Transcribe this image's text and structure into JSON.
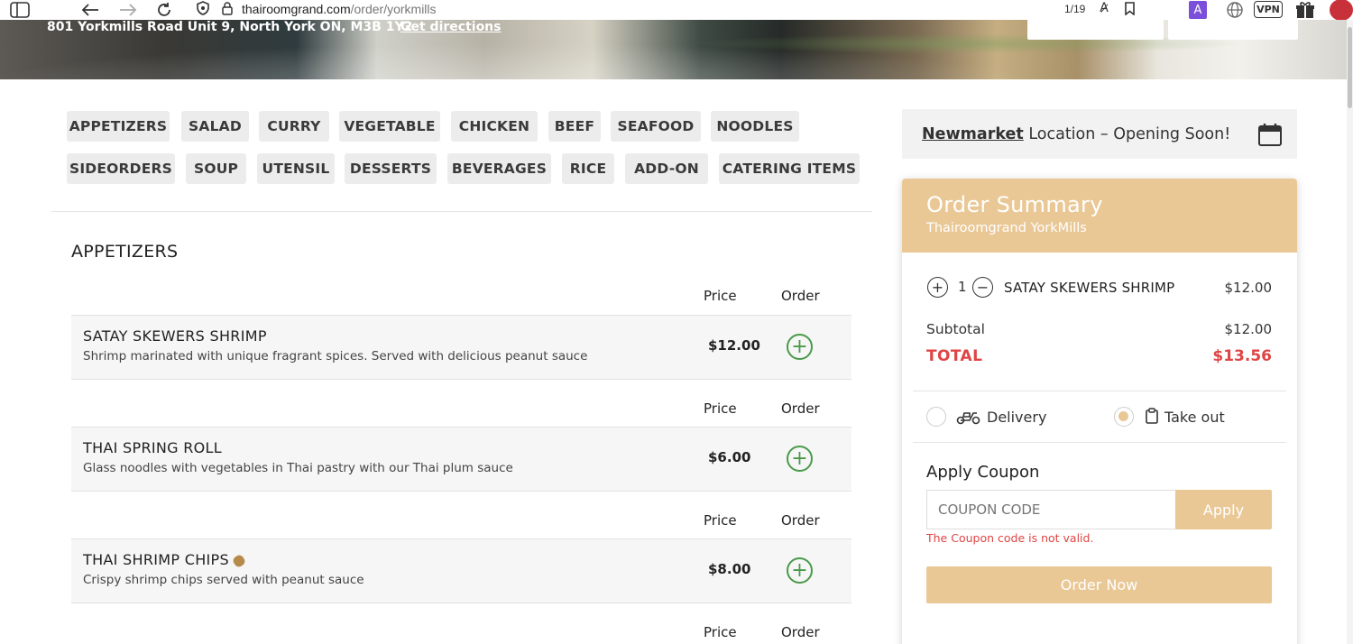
{
  "browser": {
    "url_domain": "thairoomgrand.com",
    "url_path": "/order/yorkmills",
    "page_count": "1/19",
    "vpn_label": "VPN",
    "ext_label": "A"
  },
  "hero": {
    "address": "801 Yorkmills Road Unit 9, North York ON, M3B 1Y2",
    "directions": "Get directions"
  },
  "categories": [
    "APPETIZERS",
    "SALAD",
    "CURRY",
    "VEGETABLE",
    "CHICKEN",
    "BEEF",
    "SEAFOOD",
    "NOODLES",
    "SIDEORDERS",
    "SOUP",
    "UTENSIL",
    "DESSERTS",
    "BEVERAGES",
    "RICE",
    "ADD-ON",
    "CATERING ITEMS"
  ],
  "menu": {
    "section_title": "APPETIZERS",
    "price_header": "Price",
    "order_header": "Order",
    "items": [
      {
        "name": "SATAY SKEWERS SHRIMP",
        "desc": "Shrimp marinated with unique fragrant spices. Served with delicious peanut sauce",
        "price": "$12.00"
      },
      {
        "name": "THAI SPRING ROLL",
        "desc": "Glass noodles with vegetables in Thai pastry with our Thai plum sauce",
        "price": "$6.00"
      },
      {
        "name": "THAI SHRIMP CHIPS",
        "desc": "Crispy shrimp chips served with peanut sauce",
        "price": "$8.00"
      }
    ]
  },
  "notice": {
    "location": "Newmarket",
    "text": " Location – Opening Soon!"
  },
  "summary": {
    "title": "Order Summary",
    "subtitle": "Thairoomgrand YorkMills",
    "cart": {
      "qty": "1",
      "name": "SATAY SKEWERS SHRIMP",
      "price": "$12.00"
    },
    "subtotal_label": "Subtotal",
    "subtotal": "$12.00",
    "total_label": "TOTAL",
    "total": "$13.56",
    "delivery_label": "Delivery",
    "takeout_label": "Take out",
    "selected_option": "Take out",
    "coupon_title": "Apply Coupon",
    "coupon_placeholder": "COUPON CODE",
    "apply_label": "Apply",
    "coupon_error": "The Coupon code is not valid.",
    "order_now_label": "Order Now"
  },
  "colors": {
    "accent": "#e9c896",
    "total_red": "#e04444",
    "add_green": "#4a9a4a"
  }
}
